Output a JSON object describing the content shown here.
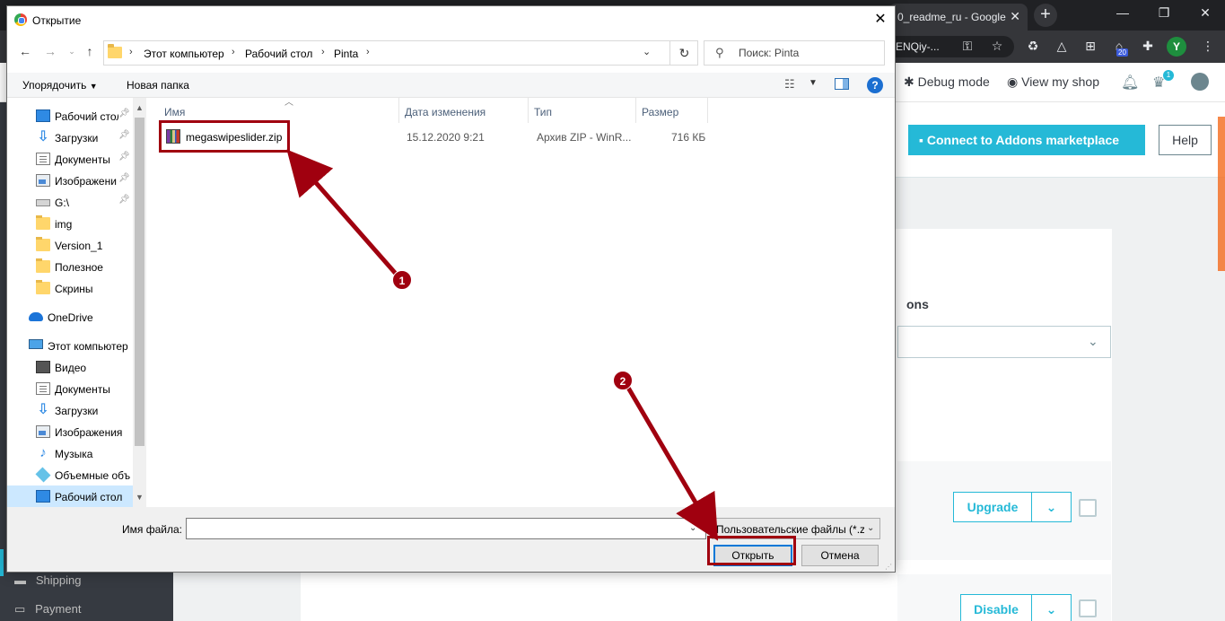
{
  "browser": {
    "tab_title": "0_readme_ru - Google",
    "url_fragment": "ENQiy-...",
    "new_tab": "+",
    "avatar_letter": "Y",
    "ext_badge": "20"
  },
  "prestashop": {
    "header": {
      "debug_mode": "Debug mode",
      "view_shop": "View my shop",
      "notif_count": "1"
    },
    "toolbar": {
      "connect_label": "Connect to Addons marketplace",
      "help_label": "Help"
    },
    "section_label": "ons",
    "buttons": {
      "upgrade": "Upgrade",
      "disable": "Disable"
    },
    "sidebar": {
      "shipping": "Shipping",
      "payment": "Payment"
    }
  },
  "dialog": {
    "title": "Открытие",
    "breadcrumb": [
      "Этот компьютер",
      "Рабочий стол",
      "Pinta"
    ],
    "search_placeholder": "Поиск: Pinta",
    "commands": {
      "organize": "Упорядочить",
      "new_folder": "Новая папка"
    },
    "nav_items": [
      {
        "label": "Рабочий стол",
        "icon": "desktop-icon",
        "pinned": true
      },
      {
        "label": "Загрузки",
        "icon": "downloads-icon",
        "pinned": true
      },
      {
        "label": "Документы",
        "icon": "documents-icon",
        "pinned": true
      },
      {
        "label": "Изображени",
        "icon": "pictures-icon",
        "pinned": true
      },
      {
        "label": "G:\\",
        "icon": "drive-icon",
        "pinned": true
      },
      {
        "label": "img",
        "icon": "folder-icon"
      },
      {
        "label": "Version_1",
        "icon": "folder-icon"
      },
      {
        "label": "Полезное",
        "icon": "folder-icon"
      },
      {
        "label": "Скрины",
        "icon": "folder-icon"
      },
      {
        "label": "OneDrive",
        "icon": "onedrive-icon"
      },
      {
        "label": "Этот компьютер",
        "icon": "this-pc-icon"
      },
      {
        "label": "Видео",
        "icon": "video-icon"
      },
      {
        "label": "Документы",
        "icon": "documents-icon"
      },
      {
        "label": "Загрузки",
        "icon": "downloads-icon"
      },
      {
        "label": "Изображения",
        "icon": "pictures-icon"
      },
      {
        "label": "Музыка",
        "icon": "music-icon"
      },
      {
        "label": "Объемные объ",
        "icon": "3d-objects-icon"
      },
      {
        "label": "Рабочий стол",
        "icon": "desktop-icon",
        "selected": true
      }
    ],
    "columns": [
      "Имя",
      "Дата изменения",
      "Тип",
      "Размер"
    ],
    "files": [
      {
        "name": "megaswipeslider.zip",
        "date": "15.12.2020 9:21",
        "type": "Архив ZIP - WinR...",
        "size": "716 КБ"
      }
    ],
    "file_name_label": "Имя файла:",
    "file_name_value": "",
    "filter": "Пользовательские файлы (*.z",
    "open_button": "Открыть",
    "cancel_button": "Отмена"
  },
  "annotations": {
    "step1": "1",
    "step2": "2",
    "color": "#a0000f"
  }
}
